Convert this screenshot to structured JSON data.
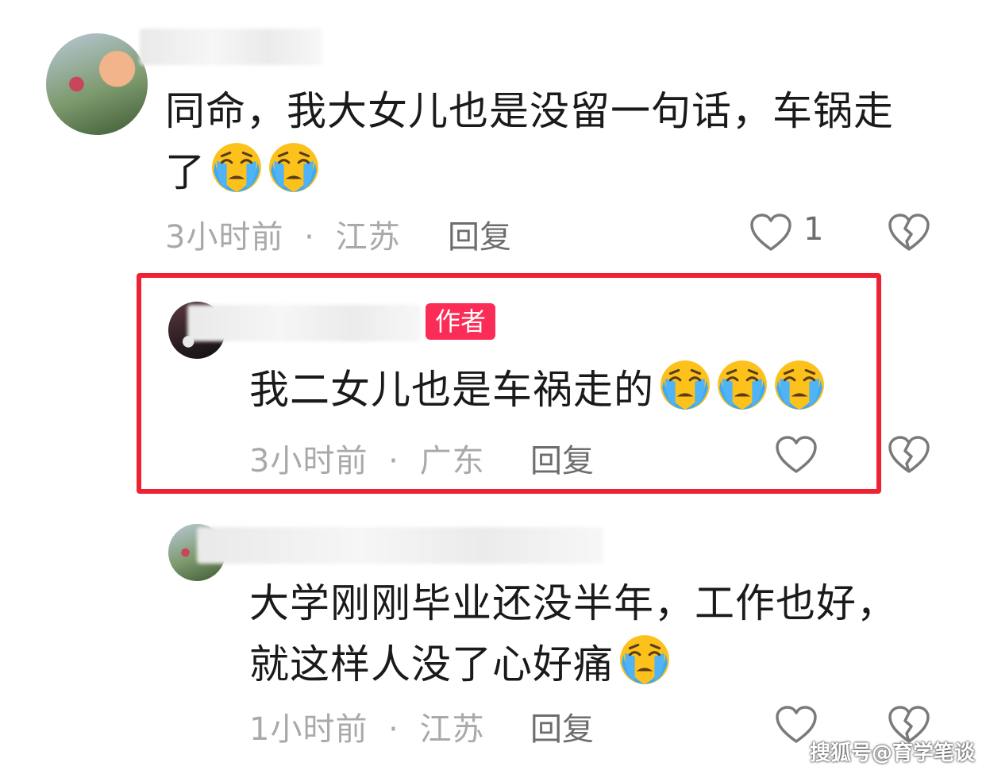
{
  "comments": [
    {
      "text_line1": "同命，我大女儿也是没留一句话，车锅走",
      "text_line2": "了",
      "emoji_count": 2,
      "time": "3小时前",
      "sep": "·",
      "location": "江苏",
      "reply_label": "回复",
      "like_count": "1"
    },
    {
      "badge": "作者",
      "text_line1": "我二女儿也是车祸走的",
      "emoji_count": 3,
      "time": "3小时前",
      "sep": "·",
      "location": "广东",
      "reply_label": "回复"
    },
    {
      "text_line1": "大学刚刚毕业还没半年，工作也好，",
      "text_line2": "就这样人没了心好痛",
      "emoji_count": 1,
      "time": "1小时前",
      "sep": "·",
      "location": "江苏",
      "reply_label": "回复"
    }
  ],
  "watermark": "搜狐号@育学笔谈",
  "colors": {
    "highlight": "#ee2233",
    "badge": "#fb2c55",
    "meta_text": "#a9a9a9"
  },
  "icons": {
    "like": "heart-outline-icon",
    "dislike": "broken-heart-icon",
    "emoji": "loudly-crying-face-emoji"
  }
}
